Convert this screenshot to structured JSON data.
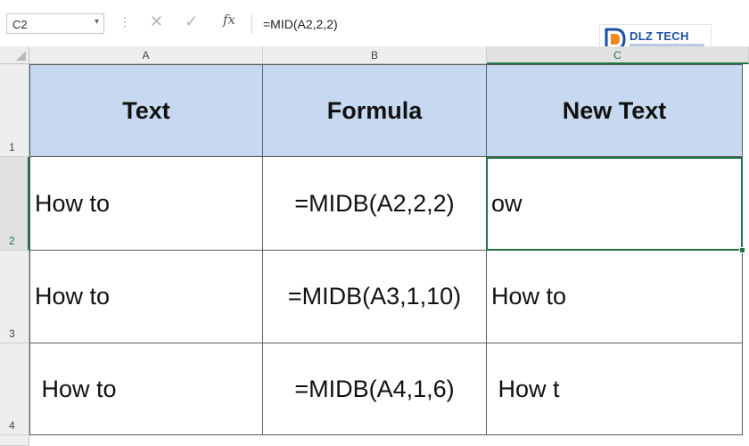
{
  "formula_bar": {
    "name_box": "C2",
    "name_box_arrow": "▾",
    "separator": "⋮",
    "cancel_glyph": "✕",
    "enter_glyph": "✓",
    "fx_label": "fx",
    "formula": "=MID(A2,2,2)"
  },
  "logo": {
    "text": "DLZ TECH"
  },
  "columns": [
    "A",
    "B",
    "C"
  ],
  "active_column": "C",
  "rows": [
    "1",
    "2",
    "3",
    "4"
  ],
  "active_row": "2",
  "sheet": {
    "header": {
      "a": "Text",
      "b": "Formula",
      "c": "New Text"
    },
    "data": [
      {
        "a": "How to",
        "b": "=MIDB(A2,2,2)",
        "c": "ow"
      },
      {
        "a": "How to",
        "b": "=MIDB(A3,1,10)",
        "c": "How to"
      },
      {
        "a": " How to",
        "b": "=MIDB(A4,1,6)",
        "c": " How t"
      }
    ]
  },
  "colors": {
    "header_fill": "#c6d9f0",
    "selection": "#217346"
  }
}
